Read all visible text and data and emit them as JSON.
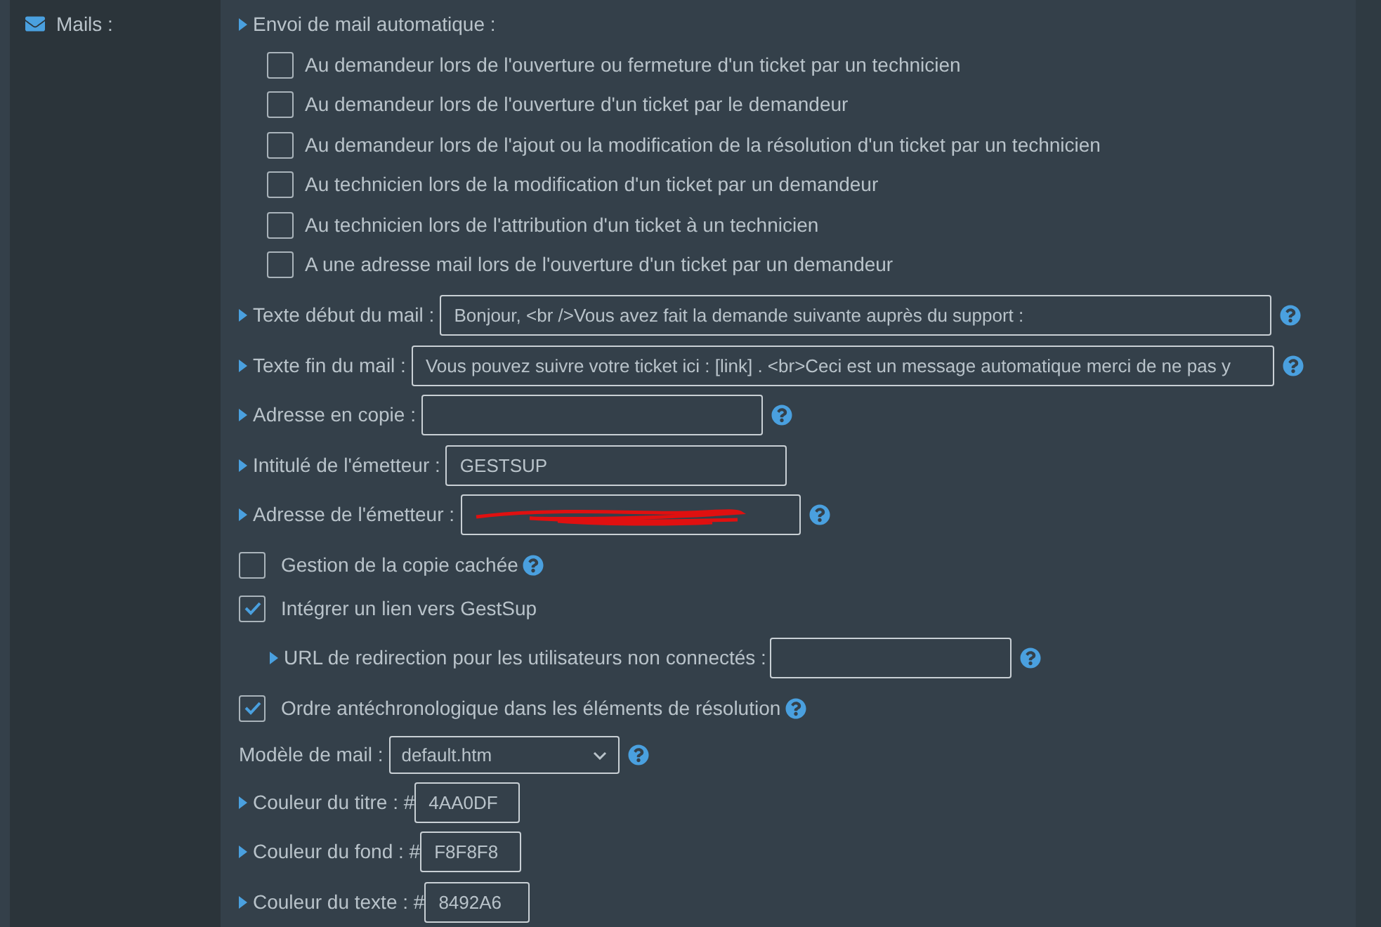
{
  "section": {
    "title": "Mails :"
  },
  "auto_mail": {
    "label": "Envoi de mail automatique :",
    "options": [
      {
        "label": "Au demandeur lors de l'ouverture ou fermeture d'un ticket par un technicien",
        "checked": false
      },
      {
        "label": "Au demandeur lors de l'ouverture d'un ticket par le demandeur",
        "checked": false
      },
      {
        "label": "Au demandeur lors de l'ajout ou la modification de la résolution d'un ticket par un technicien",
        "checked": false
      },
      {
        "label": "Au technicien lors de la modification d'un ticket par un demandeur",
        "checked": false
      },
      {
        "label": "Au technicien lors de l'attribution d'un ticket à un technicien",
        "checked": false
      },
      {
        "label": "A une adresse mail lors de l'ouverture d'un ticket par un demandeur",
        "checked": false
      }
    ]
  },
  "text_fields": [
    {
      "label": "Texte début du mail :",
      "value": "Bonjour, <br />Vous avez fait la demande suivante auprès du support :",
      "help": true
    },
    {
      "label": "Texte fin du mail :",
      "value": "Vous pouvez suivre votre ticket ici : [link] . <br>Ceci est un message automatique merci de ne pas y",
      "help": true
    },
    {
      "label": "Adresse en copie :",
      "help": true
    },
    {
      "label": "Intitulé de l'émetteur :",
      "value": "GESTSUP",
      "help": false
    },
    {
      "label": "Adresse de l'émetteur :",
      "redacted": true,
      "help": true
    }
  ],
  "options": [
    {
      "kind": "checkbox",
      "label": "Gestion de la copie cachée",
      "checked": false,
      "help": true
    },
    {
      "kind": "checkbox",
      "label": "Intégrer un lien vers GestSup",
      "checked": true,
      "help": false
    },
    {
      "kind": "subfield",
      "label": "URL de redirection pour les utilisateurs non connectés :",
      "help": true
    },
    {
      "kind": "checkbox",
      "label": "Ordre antéchronologique dans les éléments de résolution",
      "checked": true,
      "help": true
    }
  ],
  "template": {
    "label": "Modèle de mail :",
    "value": "default.htm",
    "help": true
  },
  "colors": [
    {
      "label": "Couleur du titre : #",
      "value": "4AA0DF"
    },
    {
      "label": "Couleur du fond : #",
      "value": "F8F8F8"
    },
    {
      "label": "Couleur du texte : #",
      "value": "8492A6"
    }
  ]
}
